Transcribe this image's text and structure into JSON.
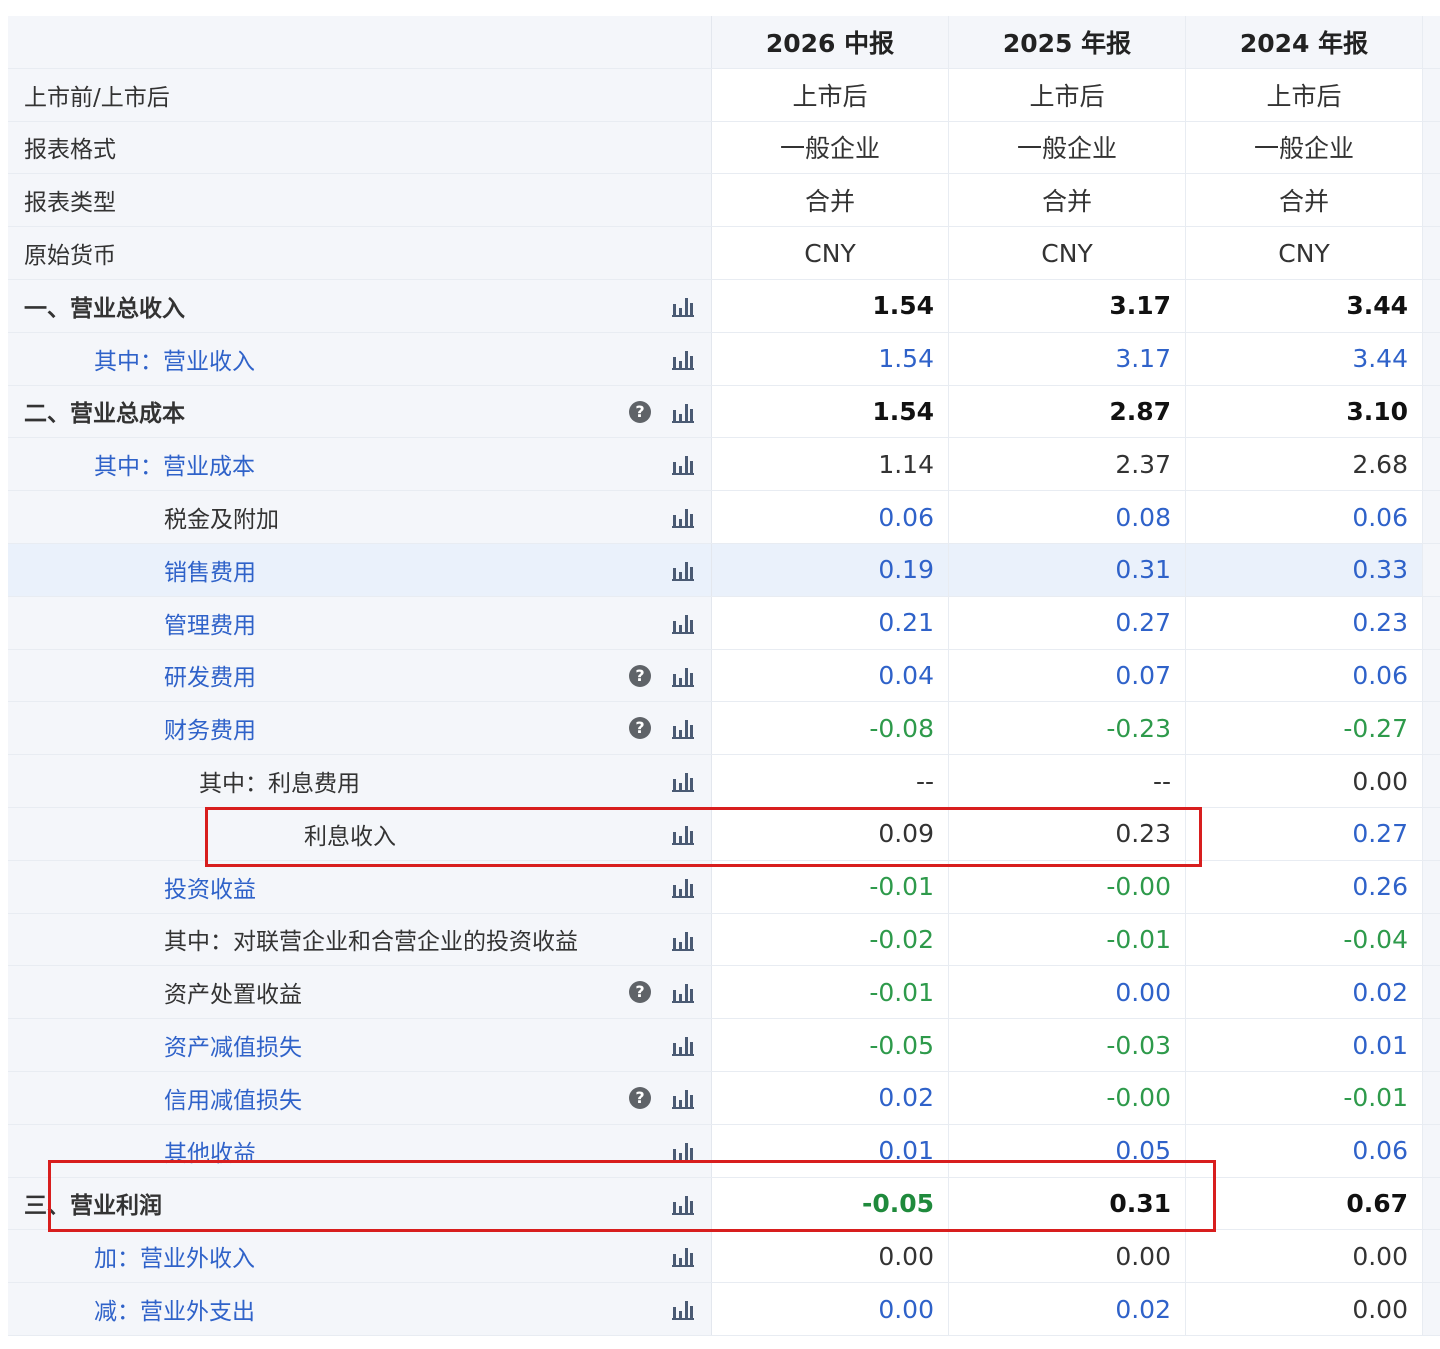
{
  "header": {
    "columns": [
      "2026 中报",
      "2025 年报",
      "2024 年报"
    ]
  },
  "rows": [
    {
      "label": "上市前/上市后",
      "values": [
        "上市后",
        "上市后",
        "上市后"
      ],
      "type": "meta"
    },
    {
      "label": "报表格式",
      "values": [
        "一般企业",
        "一般企业",
        "一般企业"
      ],
      "type": "meta"
    },
    {
      "label": "报表类型",
      "values": [
        "合并",
        "合并",
        "合并"
      ],
      "type": "meta"
    },
    {
      "label": "原始货币",
      "values": [
        "CNY",
        "CNY",
        "CNY"
      ],
      "type": "meta"
    },
    {
      "label": "一、营业总收入",
      "values": [
        "1.54",
        "3.17",
        "3.44"
      ],
      "type": "bold"
    },
    {
      "label": "其中：营业收入",
      "values": [
        "1.54",
        "3.17",
        "3.44"
      ],
      "type": "sub"
    },
    {
      "label": "二、营业总成本",
      "values": [
        "1.54",
        "2.87",
        "3.10"
      ],
      "type": "bold"
    },
    {
      "label": "其中：营业成本",
      "values": [
        "1.14",
        "2.37",
        "2.68"
      ],
      "type": "sub"
    },
    {
      "label": "税金及附加",
      "values": [
        "0.06",
        "0.08",
        "0.06"
      ],
      "type": "item"
    },
    {
      "label": "销售费用",
      "values": [
        "0.19",
        "0.31",
        "0.33"
      ],
      "type": "item"
    },
    {
      "label": "管理费用",
      "values": [
        "0.21",
        "0.27",
        "0.23"
      ],
      "type": "item"
    },
    {
      "label": "研发费用",
      "values": [
        "0.04",
        "0.07",
        "0.06"
      ],
      "type": "item"
    },
    {
      "label": "财务费用",
      "values": [
        "-0.08",
        "-0.23",
        "-0.27"
      ],
      "type": "item"
    },
    {
      "label": "其中：利息费用",
      "values": [
        "--",
        "--",
        "0.00"
      ],
      "type": "item"
    },
    {
      "label": "利息收入",
      "values": [
        "0.09",
        "0.23",
        "0.27"
      ],
      "type": "item"
    },
    {
      "label": "投资收益",
      "values": [
        "-0.01",
        "-0.00",
        "0.26"
      ],
      "type": "item"
    },
    {
      "label": "其中：对联营企业和合营企业的投资收益",
      "values": [
        "-0.02",
        "-0.01",
        "-0.04"
      ],
      "type": "item"
    },
    {
      "label": "资产处置收益",
      "values": [
        "-0.01",
        "0.00",
        "0.02"
      ],
      "type": "item"
    },
    {
      "label": "资产减值损失",
      "values": [
        "-0.05",
        "-0.03",
        "0.01"
      ],
      "type": "item"
    },
    {
      "label": "信用减值损失",
      "values": [
        "0.02",
        "-0.00",
        "-0.01"
      ],
      "type": "item"
    },
    {
      "label": "其他收益",
      "values": [
        "0.01",
        "0.05",
        "0.06"
      ],
      "type": "item"
    },
    {
      "label": "三、营业利润",
      "values": [
        "-0.05",
        "0.31",
        "0.67"
      ],
      "type": "bold"
    },
    {
      "label": "加：营业外收入",
      "values": [
        "0.00",
        "0.00",
        "0.00"
      ],
      "type": "sub"
    },
    {
      "label": "减：营业外支出",
      "values": [
        "0.00",
        "0.02",
        "0.00"
      ],
      "type": "sub"
    }
  ],
  "icons": {
    "chart": "bar-chart-icon",
    "help": "help-icon"
  },
  "colors": {
    "label_bg": "#f4f6fa",
    "link_blue": "#2f62c9",
    "negative_green": "#2e9a4b",
    "highlight_red": "#d81e1e"
  }
}
